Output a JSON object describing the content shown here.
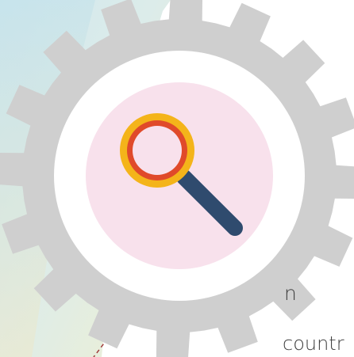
{
  "text_fragments": [
    "n",
    "countr"
  ],
  "icon": "magnifying-glass-icon",
  "colors": {
    "gear": "#cfcfcf",
    "gear_inner_ring": "#ffffff",
    "circle_fill": "#f8e1ec",
    "lens_outer": "#f4b41a",
    "lens_inner": "#e04a2a",
    "handle": "#2f4b6e",
    "text": "#3f3f3f",
    "accent_dash": "#a03a3a"
  }
}
